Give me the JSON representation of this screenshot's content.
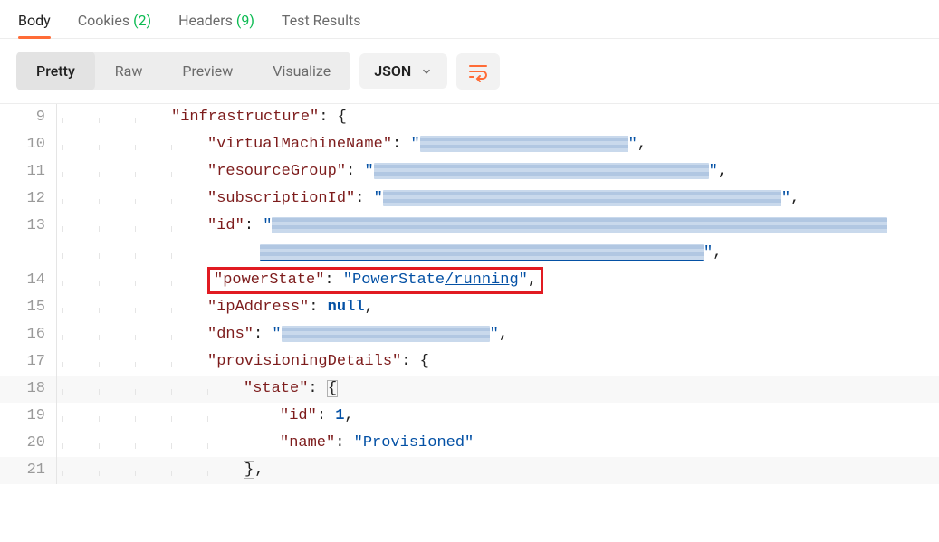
{
  "tabs": {
    "body": "Body",
    "cookies": "Cookies",
    "cookies_count": "(2)",
    "headers": "Headers",
    "headers_count": "(9)",
    "test_results": "Test Results"
  },
  "view_modes": {
    "pretty": "Pretty",
    "raw": "Raw",
    "preview": "Preview",
    "visualize": "Visualize",
    "type": "JSON"
  },
  "code": {
    "lines": [
      "9",
      "10",
      "11",
      "12",
      "13",
      "14",
      "15",
      "16",
      "17",
      "18",
      "19",
      "20",
      "21"
    ],
    "keys": {
      "infrastructure": "\"infrastructure\"",
      "vmn": "\"virtualMachineName\"",
      "rg": "\"resourceGroup\"",
      "sub": "\"subscriptionId\"",
      "id": "\"id\"",
      "power": "\"powerState\"",
      "ip": "\"ipAddress\"",
      "dns": "\"dns\"",
      "prov": "\"provisioningDetails\"",
      "state": "\"state\"",
      "inner_id": "\"id\"",
      "name": "\"name\""
    },
    "vals": {
      "power": "\"PowerState",
      "power_link": "/running",
      "power_end": "\"",
      "null": "null",
      "one": "1",
      "provisioned": "\"Provisioned\""
    }
  }
}
